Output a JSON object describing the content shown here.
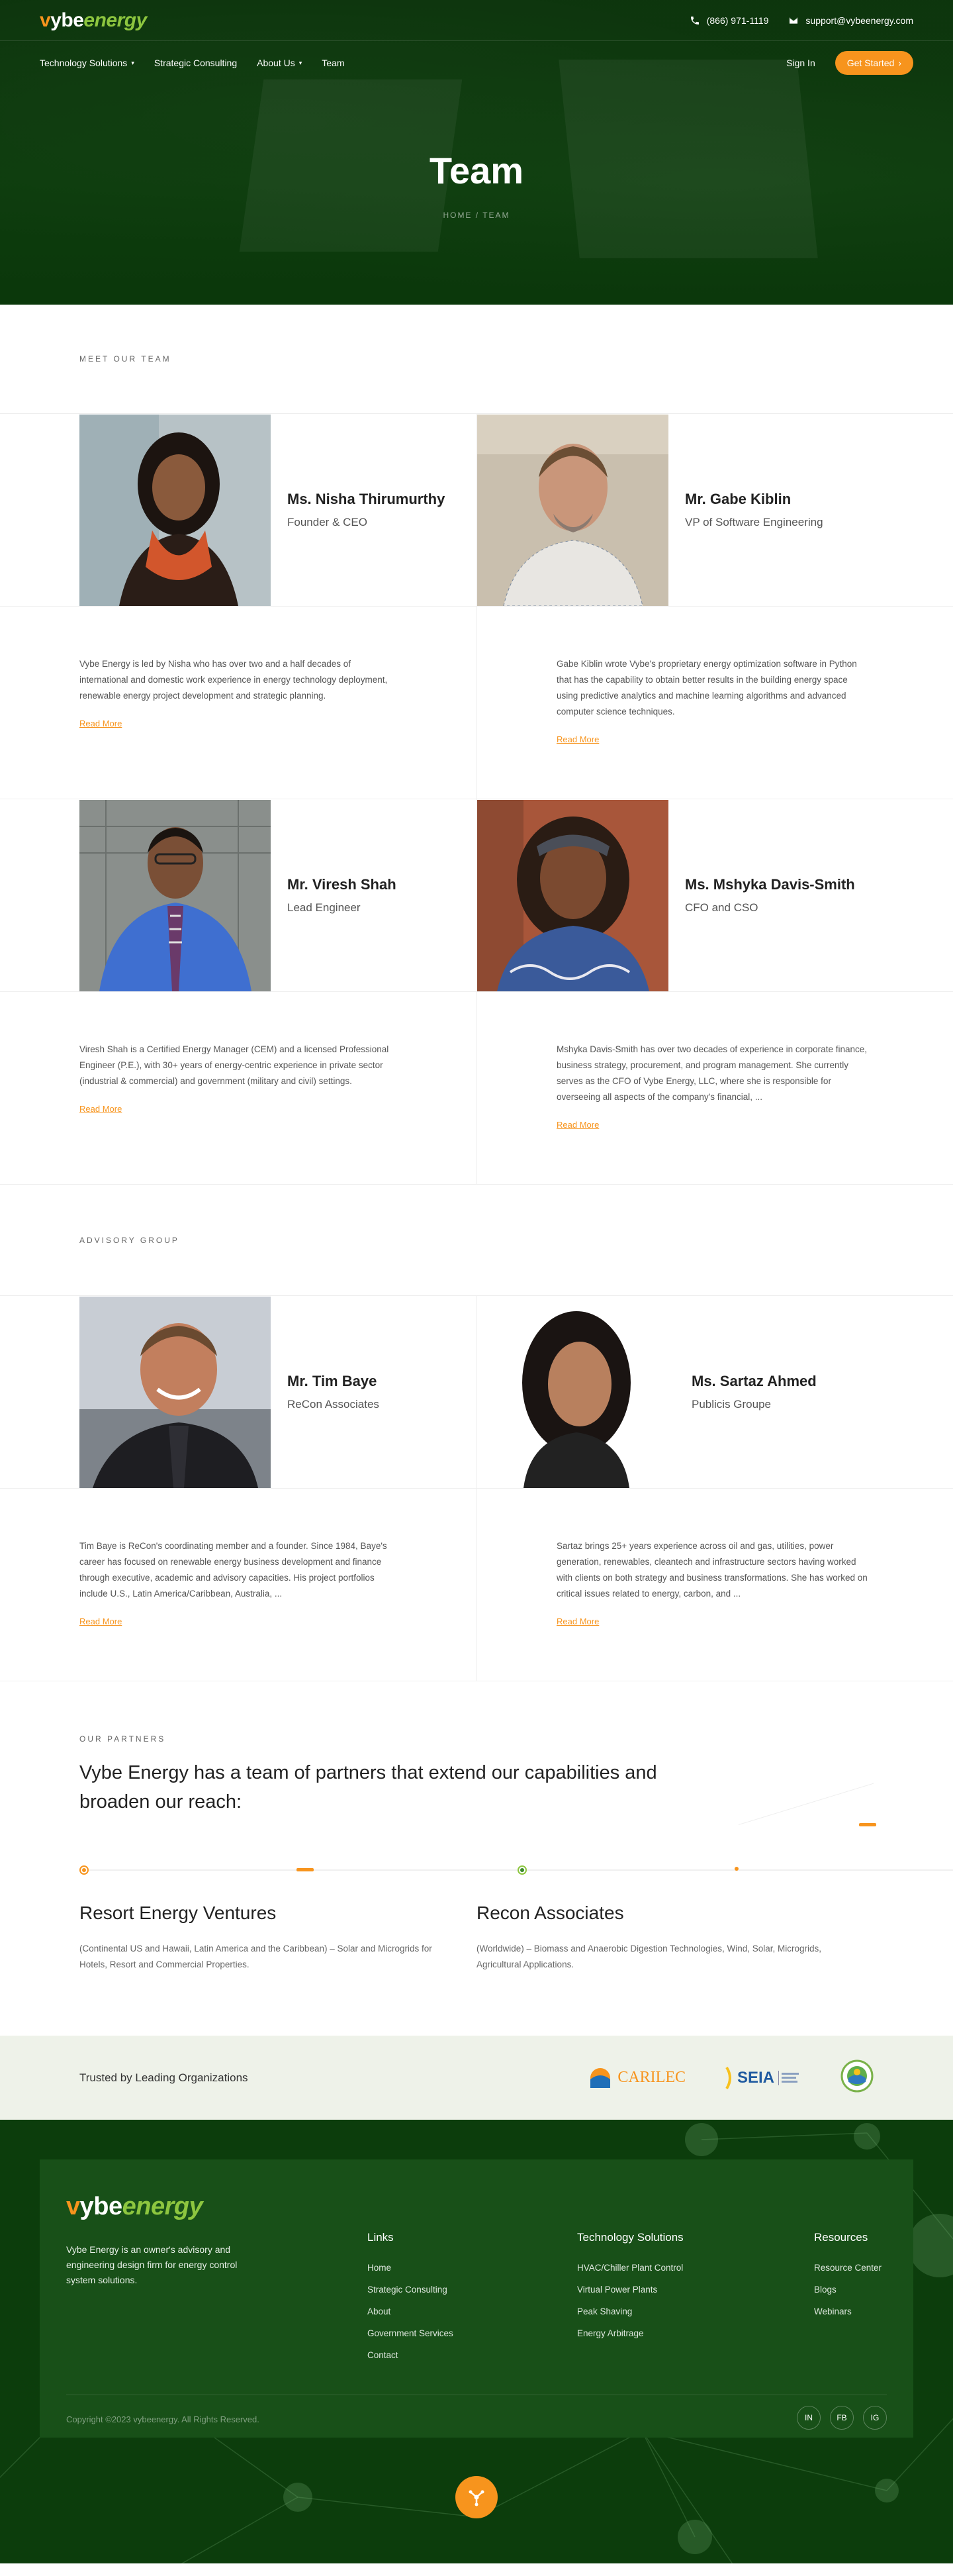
{
  "brand": {
    "logo_v": "v",
    "logo_ybe": "ybe",
    "logo_energy": "energy"
  },
  "topbar": {
    "phone": "(866) 971-1119",
    "email": "support@vybeenergy.com"
  },
  "nav": {
    "items": [
      {
        "label": "Technology Solutions",
        "dropdown": true
      },
      {
        "label": "Strategic Consulting",
        "dropdown": false
      },
      {
        "label": "About Us",
        "dropdown": true
      },
      {
        "label": "Team",
        "dropdown": false
      }
    ],
    "sign_in": "Sign In",
    "cta": "Get Started"
  },
  "hero": {
    "title": "Team",
    "breadcrumb": "HOME / TEAM"
  },
  "team": {
    "label": "MEET OUR TEAM",
    "members": [
      {
        "name": "Ms. Nisha Thirumurthy",
        "role": "Founder & CEO",
        "bio": "Vybe Energy is led by Nisha who has over two and a half decades of international and domestic work experience in energy technology deployment, renewable energy project development and strategic planning.",
        "read_more": "Read More"
      },
      {
        "name": "Mr. Gabe Kiblin",
        "role": "VP of Software Engineering",
        "bio": "Gabe Kiblin wrote Vybe's proprietary energy optimization software in Python that has the capability to obtain better results in the building energy space using predictive analytics and machine learning algorithms and advanced computer science techniques.",
        "read_more": "Read More"
      },
      {
        "name": "Mr. Viresh Shah",
        "role": "Lead Engineer",
        "bio": "Viresh Shah is a Certified Energy Manager (CEM) and a licensed Professional Engineer (P.E.), with 30+ years of energy-centric experience in private sector (industrial & commercial) and government (military and civil) settings.",
        "read_more": "Read More"
      },
      {
        "name": "Ms. Mshyka Davis-Smith",
        "role": "CFO and CSO",
        "bio": "Mshyka Davis-Smith has over two decades of experience in corporate finance, business strategy, procurement, and program management. She currently serves as the CFO of Vybe Energy, LLC, where she is responsible for overseeing all aspects of the company's financial, ...",
        "read_more": "Read More"
      }
    ]
  },
  "advisory": {
    "label": "ADVISORY GROUP",
    "members": [
      {
        "name": "Mr. Tim Baye",
        "role": "ReCon Associates",
        "bio": "Tim Baye is ReCon's coordinating member and a founder. Since 1984, Baye's career has focused on renewable energy business development and finance through executive, academic and advisory capacities. His project portfolios include U.S., Latin America/Caribbean, Australia, ...",
        "read_more": "Read More"
      },
      {
        "name": "Ms. Sartaz Ahmed",
        "role": "Publicis Groupe",
        "bio": "Sartaz brings 25+ years experience across oil and gas, utilities, power generation, renewables, cleantech and infrastructure sectors having worked with clients on both strategy and business transformations. She has worked on critical issues related to energy, carbon, and ...",
        "read_more": "Read More"
      }
    ]
  },
  "partners": {
    "label": "OUR PARTNERS",
    "title": "Vybe Energy has a team of partners that extend our capabilities and broaden our reach:",
    "items": [
      {
        "name": "Resort Energy Ventures",
        "desc": "(Continental US and Hawaii, Latin America and the Caribbean) – Solar and Microgrids for Hotels, Resort and Commercial Properties."
      },
      {
        "name": "Recon Associates",
        "desc": "(Worldwide) – Biomass and Anaerobic Digestion Technologies, Wind, Solar, Microgrids, Agricultural Applications."
      }
    ]
  },
  "trusted": {
    "label": "Trusted by Leading Organizations",
    "logos": {
      "carilec": "CARILEC",
      "seia": "SEIA"
    }
  },
  "footer": {
    "about": "Vybe Energy is an owner's advisory and engineering design firm for energy control system solutions.",
    "columns": [
      {
        "title": "Links",
        "items": [
          "Home",
          "Strategic Consulting",
          "About",
          "Government Services",
          "Contact"
        ]
      },
      {
        "title": "Technology Solutions",
        "items": [
          "HVAC/Chiller Plant Control",
          "Virtual Power Plants",
          "Peak Shaving",
          "Energy Arbitrage"
        ]
      },
      {
        "title": "Resources",
        "items": [
          "Resource Center",
          "Blogs",
          "Webinars"
        ]
      }
    ],
    "copyright": "Copyright ©2023 vybeenergy. All Rights Reserved.",
    "socials": [
      "IN",
      "FB",
      "IG"
    ]
  },
  "colors": {
    "brand_green": "#0f3f0f",
    "accent_orange": "#f7941d",
    "leaf_green": "#8dc63f"
  },
  "icons": {
    "phone": "phone-icon",
    "email": "mail-icon",
    "caret": "chevron-down-icon",
    "arrow": "arrow-right-icon",
    "fab": "vybe-mark-icon"
  }
}
